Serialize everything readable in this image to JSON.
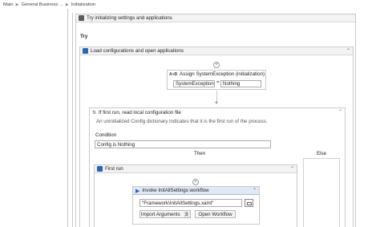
{
  "breadcrumb": [
    "Main",
    "General Business ...",
    "Initialization"
  ],
  "try_catch": {
    "title": "Try initializing settings and applications",
    "try_label": "Try"
  },
  "sequence": {
    "title": "Load configurations and open applications"
  },
  "assign": {
    "title": "Assign SystemException (initialization)",
    "prefix": "A+B",
    "to": "SystemException",
    "value": "Nothing"
  },
  "if_activity": {
    "title": "If first run, read local configuration file",
    "description": "An uninitialized Config dictionary indicates that it is the first run of the process.",
    "condition_label": "Condition",
    "condition": "Config is Nothing",
    "then_label": "Then",
    "else_label": "Else"
  },
  "first_run": {
    "title": "First run"
  },
  "invoke": {
    "title": "Invoke InitAllSettings workflow",
    "path": "\"Framework\\InitAllSettings.xaml\"",
    "import_label": "Import Arguments",
    "import_count": "3",
    "open_label": "Open Workflow"
  },
  "colors": {
    "accent": "#2b66b5",
    "header_bg": "#f3f3f3",
    "invoke_header": "#dfe8f5"
  }
}
